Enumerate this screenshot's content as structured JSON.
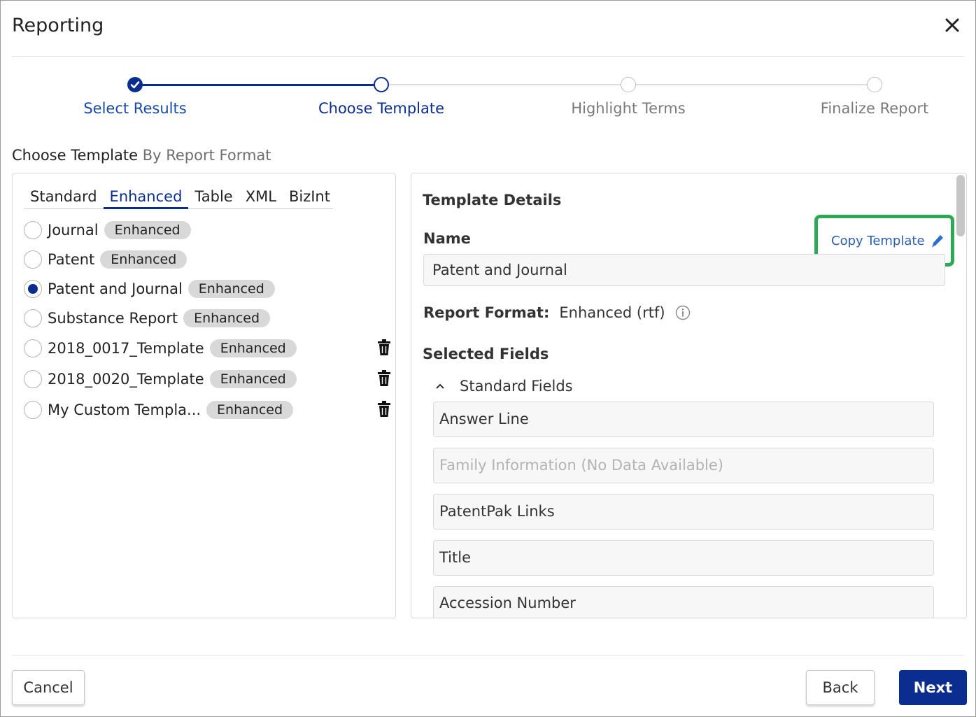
{
  "dialog": {
    "title": "Reporting",
    "close_icon": "close-icon"
  },
  "stepper": {
    "steps": [
      {
        "label": "Select Results",
        "state": "complete"
      },
      {
        "label": "Choose Template",
        "state": "current"
      },
      {
        "label": "Highlight Terms",
        "state": "upcoming"
      },
      {
        "label": "Finalize Report",
        "state": "upcoming"
      }
    ]
  },
  "section": {
    "title": "Choose Template",
    "subtitle": "By Report Format"
  },
  "tabs": [
    {
      "label": "Standard",
      "active": false
    },
    {
      "label": "Enhanced",
      "active": true
    },
    {
      "label": "Table",
      "active": false
    },
    {
      "label": "XML",
      "active": false
    },
    {
      "label": "BizInt",
      "active": false
    }
  ],
  "templates": [
    {
      "name": "Journal",
      "badge": "Enhanced",
      "selected": false,
      "deletable": false
    },
    {
      "name": "Patent",
      "badge": "Enhanced",
      "selected": false,
      "deletable": false
    },
    {
      "name": "Patent and Journal",
      "badge": "Enhanced",
      "selected": true,
      "deletable": false
    },
    {
      "name": "Substance Report",
      "badge": "Enhanced",
      "selected": false,
      "deletable": false
    },
    {
      "name": "2018_0017_Template",
      "badge": "Enhanced",
      "selected": false,
      "deletable": true
    },
    {
      "name": "2018_0020_Template",
      "badge": "Enhanced",
      "selected": false,
      "deletable": true
    },
    {
      "name": "My Custom Templa...",
      "badge": "Enhanced",
      "selected": false,
      "deletable": true
    }
  ],
  "details": {
    "title": "Template Details",
    "name_label": "Name",
    "name_value": "Patent and Journal",
    "copy_link": "Copy Template",
    "format_label": "Report Format:",
    "format_value": "Enhanced (rtf)",
    "selected_fields_label": "Selected Fields",
    "standard_fields_label": "Standard Fields",
    "fields": [
      {
        "label": "Answer Line",
        "disabled": false
      },
      {
        "label": "Family Information (No Data Available)",
        "disabled": true
      },
      {
        "label": "PatentPak Links",
        "disabled": false
      },
      {
        "label": "Title",
        "disabled": false
      },
      {
        "label": "Accession Number",
        "disabled": false
      }
    ]
  },
  "footer": {
    "cancel_label": "Cancel",
    "back_label": "Back",
    "next_label": "Next"
  },
  "colors": {
    "primary": "#0a2d8f",
    "link": "#2c5fad",
    "highlight_box": "#2ea855",
    "badge_bg": "#d8d8d8"
  }
}
